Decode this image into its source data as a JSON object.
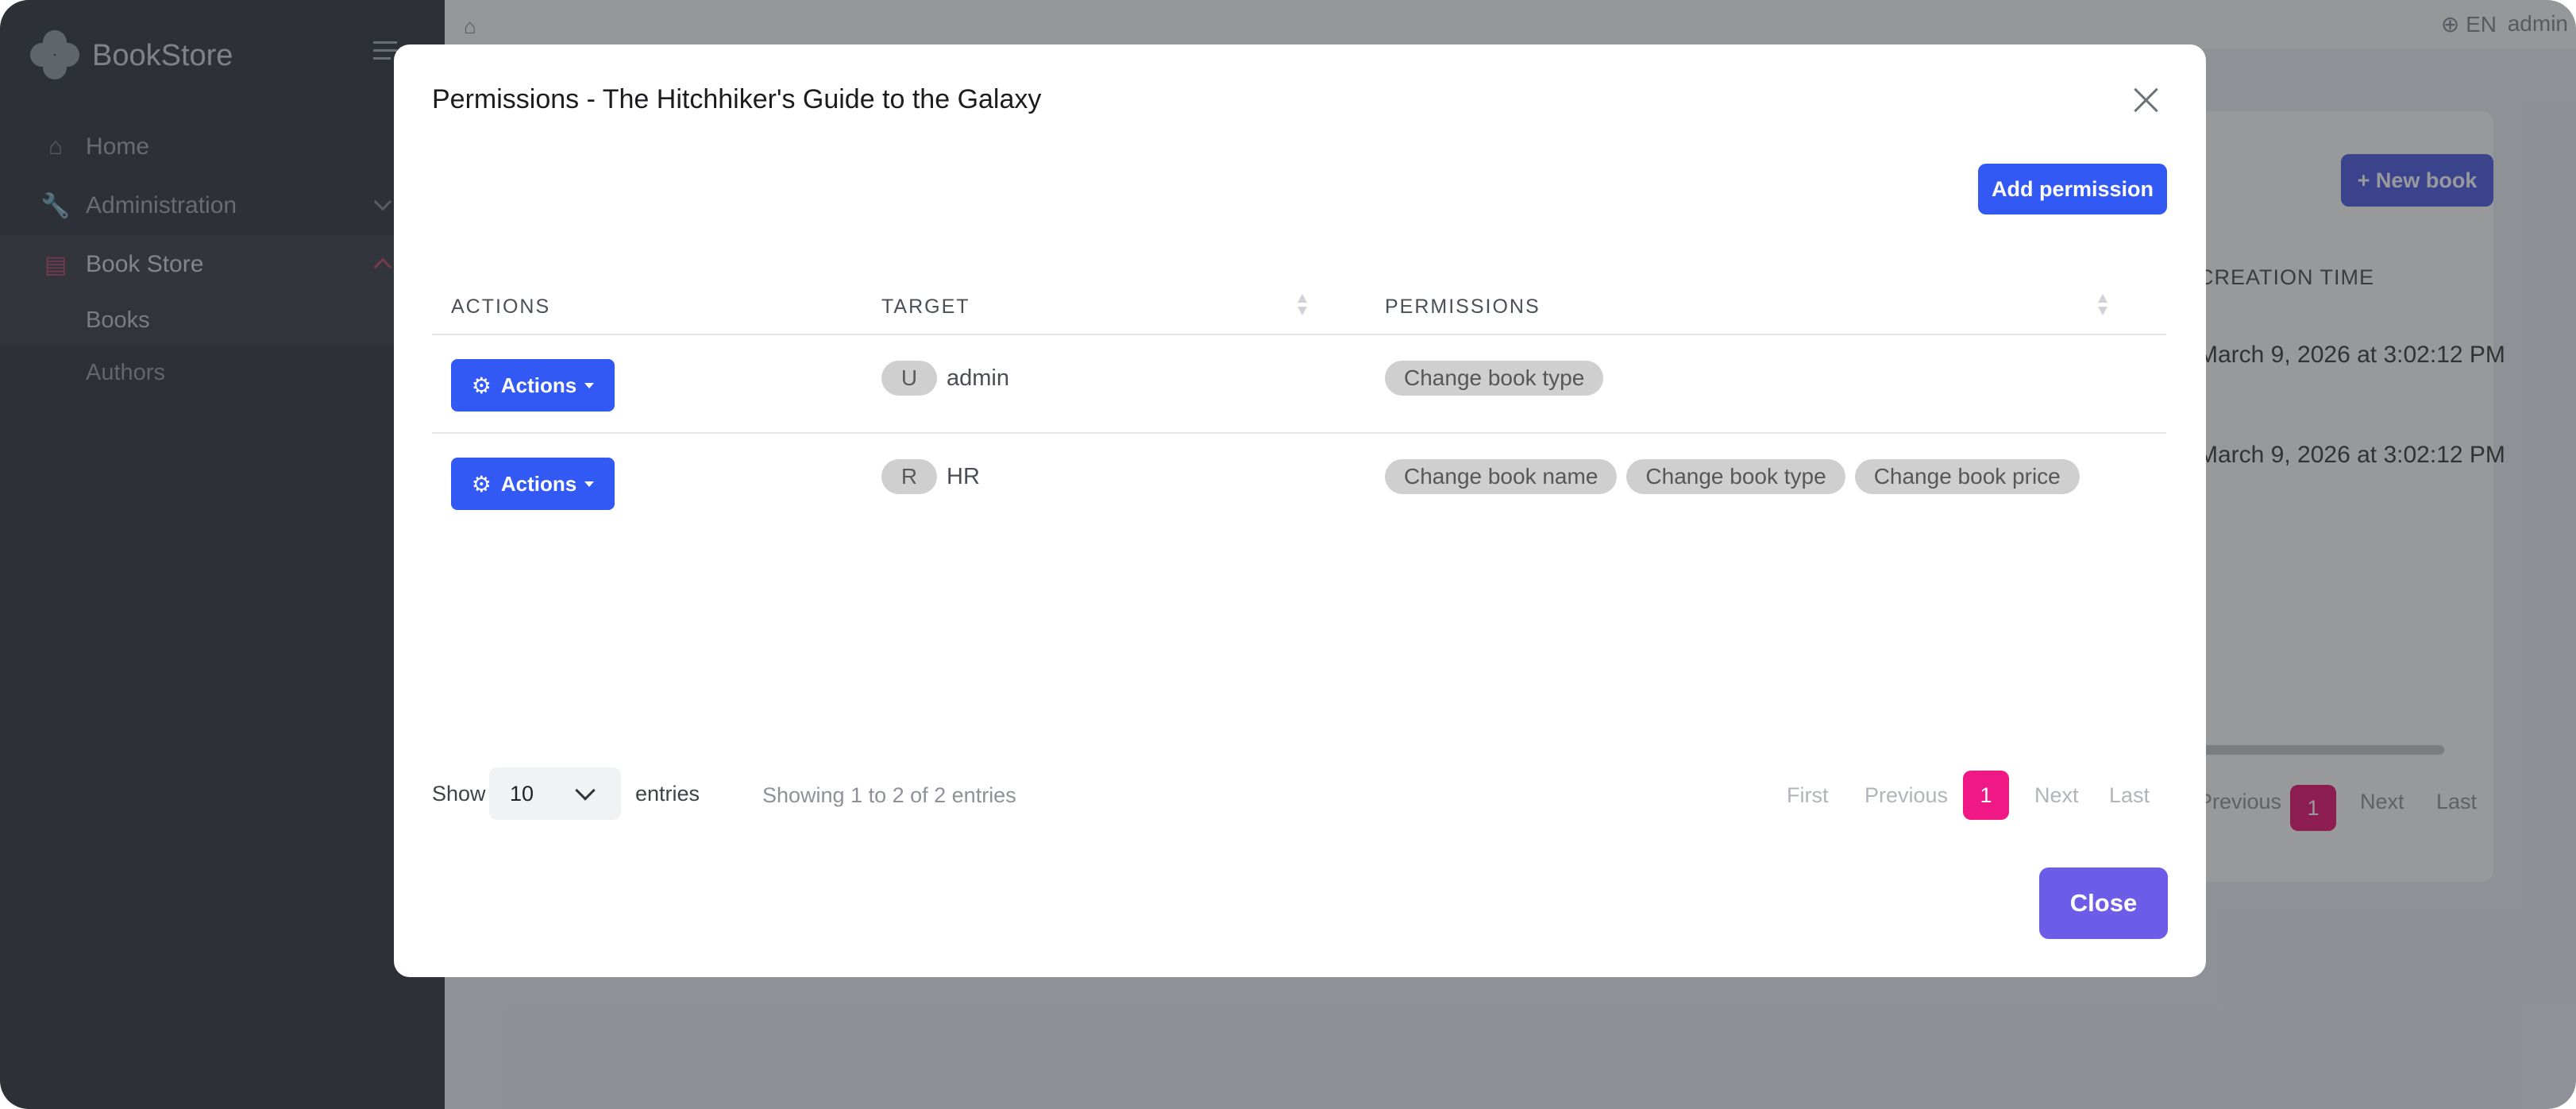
{
  "app": {
    "brand": "BookStore",
    "language": "EN",
    "user": "admin"
  },
  "sidebar": {
    "items": [
      {
        "label": "Home",
        "icon": "home-icon"
      },
      {
        "label": "Administration",
        "icon": "wrench-icon"
      },
      {
        "label": "Book Store",
        "icon": "book-icon"
      }
    ],
    "subitems": [
      {
        "label": "Books"
      },
      {
        "label": "Authors"
      }
    ]
  },
  "background": {
    "new_book_label": "+ New book",
    "column_header": "CREATION TIME",
    "rows": [
      "March 9, 2026 at 3:02:12 PM",
      "March 9, 2026 at 3:02:12 PM"
    ],
    "pager": {
      "previous": "Previous",
      "current": "1",
      "next": "Next",
      "last": "Last"
    }
  },
  "modal": {
    "title": "Permissions - The Hitchhiker's Guide to the Galaxy",
    "add_permission_label": "Add permission",
    "columns": {
      "actions": "ACTIONS",
      "target": "TARGET",
      "permissions": "PERMISSIONS"
    },
    "rows": [
      {
        "actions_label": "Actions",
        "target_type": "U",
        "target_name": "admin",
        "permissions": [
          "Change book type"
        ]
      },
      {
        "actions_label": "Actions",
        "target_type": "R",
        "target_name": "HR",
        "permissions": [
          "Change book name",
          "Change book type",
          "Change book price"
        ]
      }
    ],
    "footer": {
      "show_label": "Show",
      "page_size": "10",
      "entries_label": "entries",
      "info": "Showing 1 to 2 of 2 entries",
      "pager": {
        "first": "First",
        "previous": "Previous",
        "current": "1",
        "next": "Next",
        "last": "Last"
      }
    },
    "close_label": "Close"
  },
  "colors": {
    "primary": "#3359f5",
    "close_button": "#6c5ce7",
    "active_page": "#f01884",
    "sidebar_bg": "#3e4147",
    "badge_bg": "#cfcfcf"
  }
}
